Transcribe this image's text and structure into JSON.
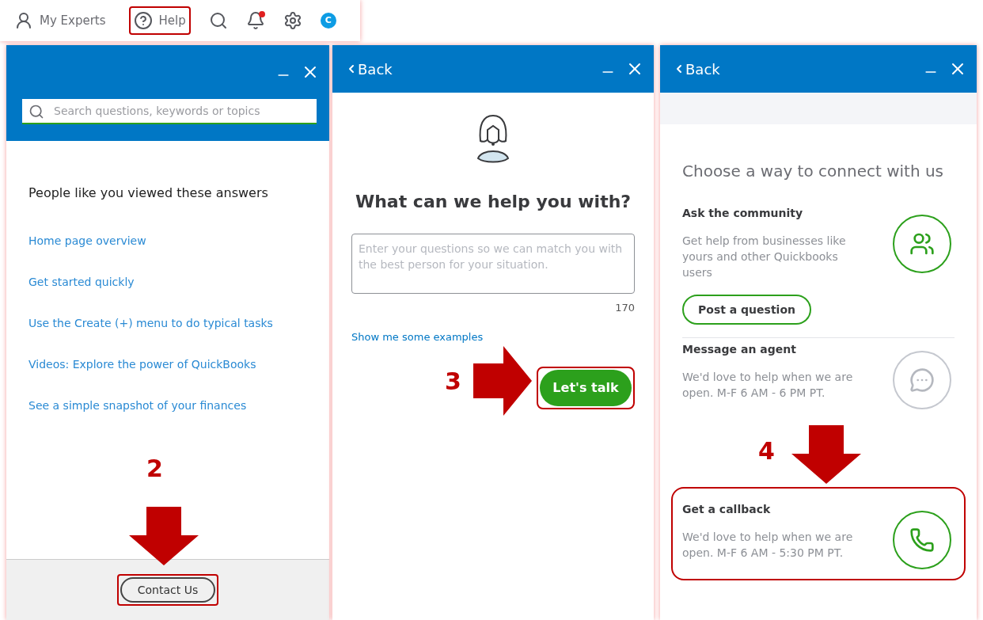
{
  "toolbar": {
    "items": [
      {
        "kind": "experts",
        "label": "My Experts",
        "highlighted": false
      },
      {
        "kind": "help",
        "label": "Help",
        "highlighted": true
      },
      {
        "kind": "search"
      },
      {
        "kind": "notifications",
        "badge": true
      },
      {
        "kind": "settings"
      },
      {
        "kind": "avatar",
        "label": "C"
      }
    ]
  },
  "search_panel": {
    "search": {
      "placeholder": "Search questions, keywords or topics"
    },
    "heading": "People like you viewed these answers",
    "links": [
      "Home page overview",
      "Get started quickly",
      "Use the Create (+) menu to do typical tasks",
      "Videos: Explore the power of QuickBooks",
      "See a simple snapshot of your finances"
    ],
    "button": {
      "label": "Contact Us",
      "highlighted": true
    },
    "annotation": {
      "step": "2"
    }
  },
  "ask_panel": {
    "back": "Back",
    "title": "What can we help you with?",
    "question": {
      "placeholder": "Enter your questions so we can match you with the best person for your situation."
    },
    "counter": "170",
    "link": "Show me some examples",
    "button": {
      "label": "Let's talk",
      "highlighted": true
    },
    "annotation": {
      "step": "3"
    }
  },
  "connect_panel": {
    "back": "Back",
    "title": "Choose a way to connect with us",
    "options": [
      {
        "kind": "community",
        "title": "Ask the community",
        "text": "Get help from businesses like yours and other Quickbooks users",
        "available": true,
        "button": "Post a question",
        "highlighted": false
      },
      {
        "kind": "message",
        "title": "Message an agent",
        "text": "We'd love to help when we are open. M-F 6 AM - 6 PM PT.",
        "available": false,
        "highlighted": false
      },
      {
        "kind": "callback",
        "title": "Get a callback",
        "text": "We'd love to help when we are open. M-F 6 AM - 5:30 PM PT.",
        "available": true,
        "highlighted": true
      }
    ],
    "annotation": {
      "step": "4"
    }
  }
}
